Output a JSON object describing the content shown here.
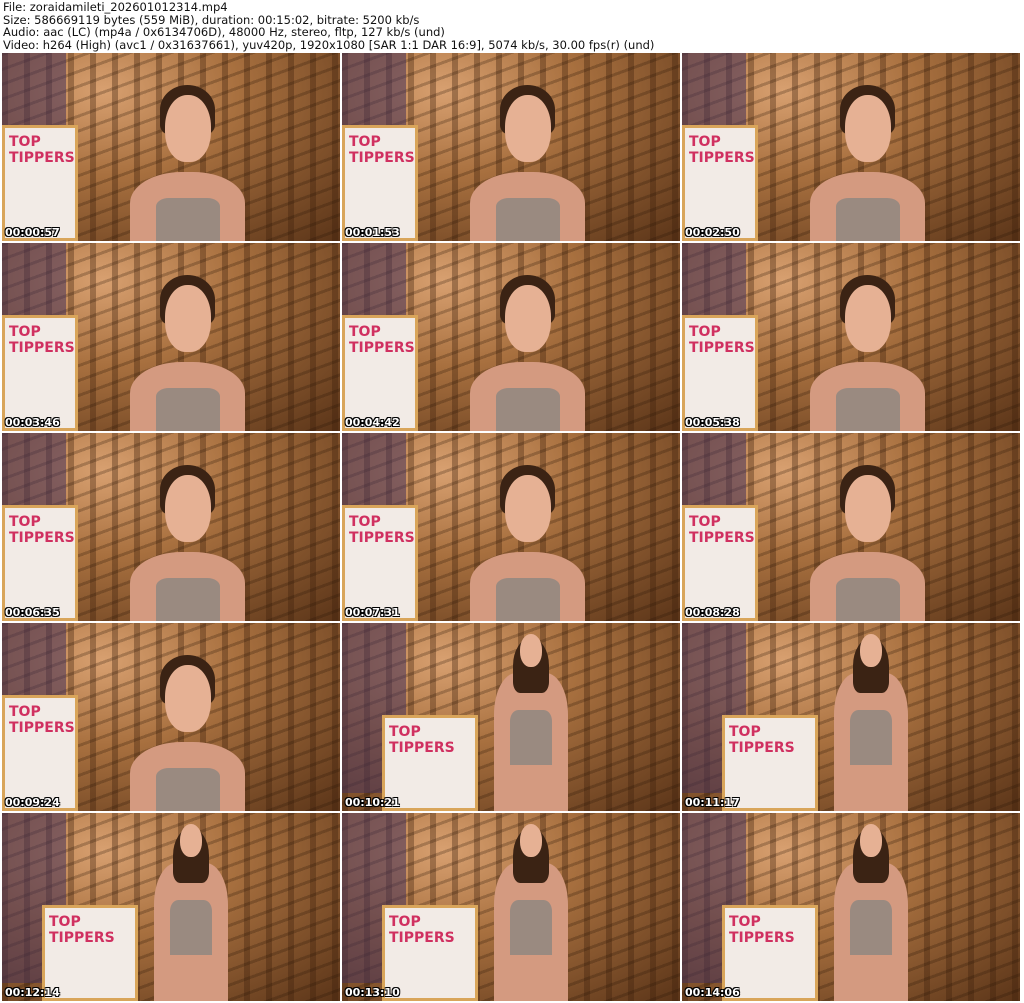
{
  "header": {
    "file": "File: zoraidamileti_202601012314.mp4",
    "size": "Size: 586669119 bytes (559 MiB), duration: 00:15:02, bitrate: 5200 kb/s",
    "audio": "Audio: aac (LC) (mp4a / 0x6134706D), 48000 Hz, stereo, fltp, 127 kb/s (und)",
    "video": "Video: h264 (High) (avc1 / 0x31637661), yuv420p, 1920x1080 [SAR 1:1 DAR 16:9], 5074 kb/s, 30.00 fps(r) (und)"
  },
  "board_label": "TOP TIPPERS",
  "thumbnails": [
    {
      "timestamp": "00:00:57"
    },
    {
      "timestamp": "00:01:53"
    },
    {
      "timestamp": "00:02:50"
    },
    {
      "timestamp": "00:03:46"
    },
    {
      "timestamp": "00:04:42"
    },
    {
      "timestamp": "00:05:38"
    },
    {
      "timestamp": "00:06:35"
    },
    {
      "timestamp": "00:07:31"
    },
    {
      "timestamp": "00:08:28"
    },
    {
      "timestamp": "00:09:24"
    },
    {
      "timestamp": "00:10:21"
    },
    {
      "timestamp": "00:11:17"
    },
    {
      "timestamp": "00:12:14"
    },
    {
      "timestamp": "00:13:10"
    },
    {
      "timestamp": "00:14:06"
    }
  ]
}
